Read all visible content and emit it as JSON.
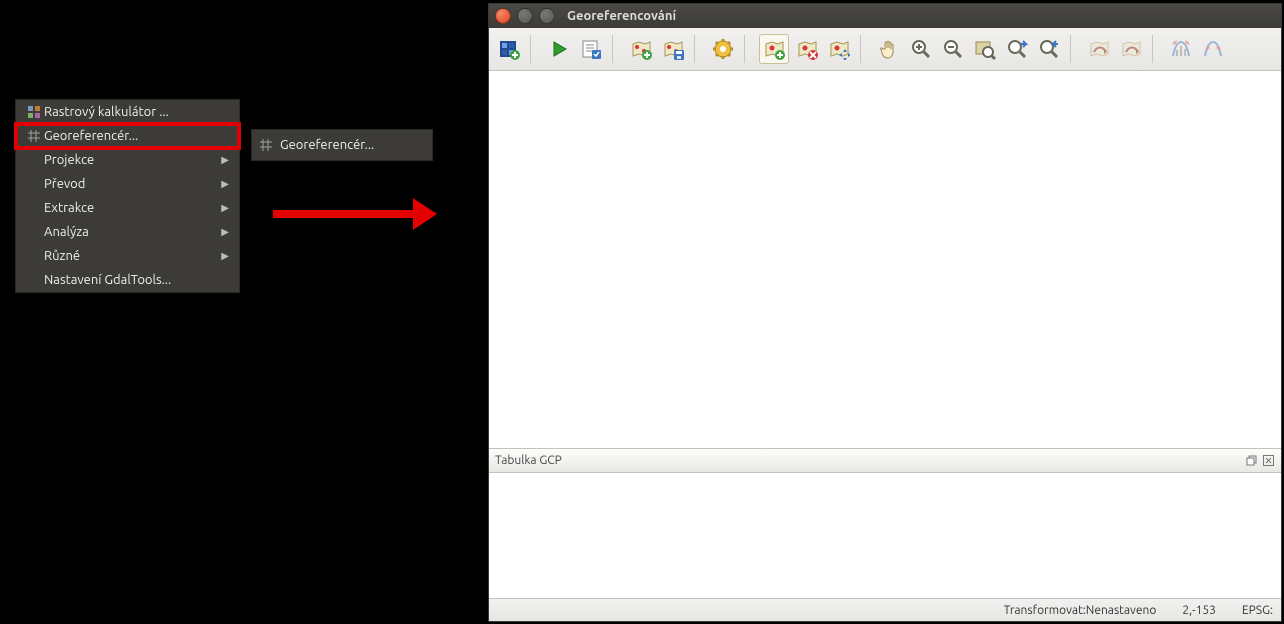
{
  "menu": {
    "items": [
      {
        "label": "Rastrový kalkulátor ...",
        "icon": "calc-icon",
        "sub": false
      },
      {
        "label": "Georeferencér...",
        "icon": "grid-icon",
        "sub": false,
        "highlight": true
      },
      {
        "label": "Projekce",
        "icon": "",
        "sub": true
      },
      {
        "label": "Převod",
        "icon": "",
        "sub": true
      },
      {
        "label": "Extrakce",
        "icon": "",
        "sub": true
      },
      {
        "label": "Analýza",
        "icon": "",
        "sub": true
      },
      {
        "label": "Různé",
        "icon": "",
        "sub": true
      },
      {
        "label": "Nastavení GdalTools...",
        "icon": "",
        "sub": false
      }
    ]
  },
  "submenu": {
    "icon": "grid-icon",
    "label": "Georeferencér..."
  },
  "window": {
    "title": "Georeferencování",
    "toolbar": [
      {
        "name": "open-raster-icon",
        "dis": false
      },
      {
        "sep": true
      },
      {
        "name": "play-icon",
        "dis": false
      },
      {
        "name": "script-icon",
        "dis": false
      },
      {
        "sep": true
      },
      {
        "name": "gcp-load-icon",
        "dis": false
      },
      {
        "name": "gcp-save-icon",
        "dis": false
      },
      {
        "sep": true
      },
      {
        "name": "settings-gear-icon",
        "dis": false
      },
      {
        "sep": true
      },
      {
        "name": "add-point-icon",
        "dis": false,
        "active": true
      },
      {
        "name": "delete-point-icon",
        "dis": false
      },
      {
        "name": "move-point-icon",
        "dis": false
      },
      {
        "sep": true
      },
      {
        "name": "pan-icon",
        "dis": false
      },
      {
        "name": "zoom-in-icon",
        "dis": false
      },
      {
        "name": "zoom-out-icon",
        "dis": false
      },
      {
        "name": "zoom-layer-icon",
        "dis": false
      },
      {
        "name": "zoom-last-icon",
        "dis": false
      },
      {
        "name": "zoom-next-icon",
        "dis": false
      },
      {
        "sep": true
      },
      {
        "name": "link-georef-icon",
        "dis": true
      },
      {
        "name": "link-qgis-icon",
        "dis": true
      },
      {
        "sep": true
      },
      {
        "name": "histogram-icon",
        "dis": true
      },
      {
        "name": "stretch-icon",
        "dis": true
      }
    ],
    "gcp_panel_title": "Tabulka GCP",
    "status": {
      "transform": "Transformovat:Nenastaveno",
      "coords": "2,-153",
      "epsg": "EPSG:"
    }
  }
}
